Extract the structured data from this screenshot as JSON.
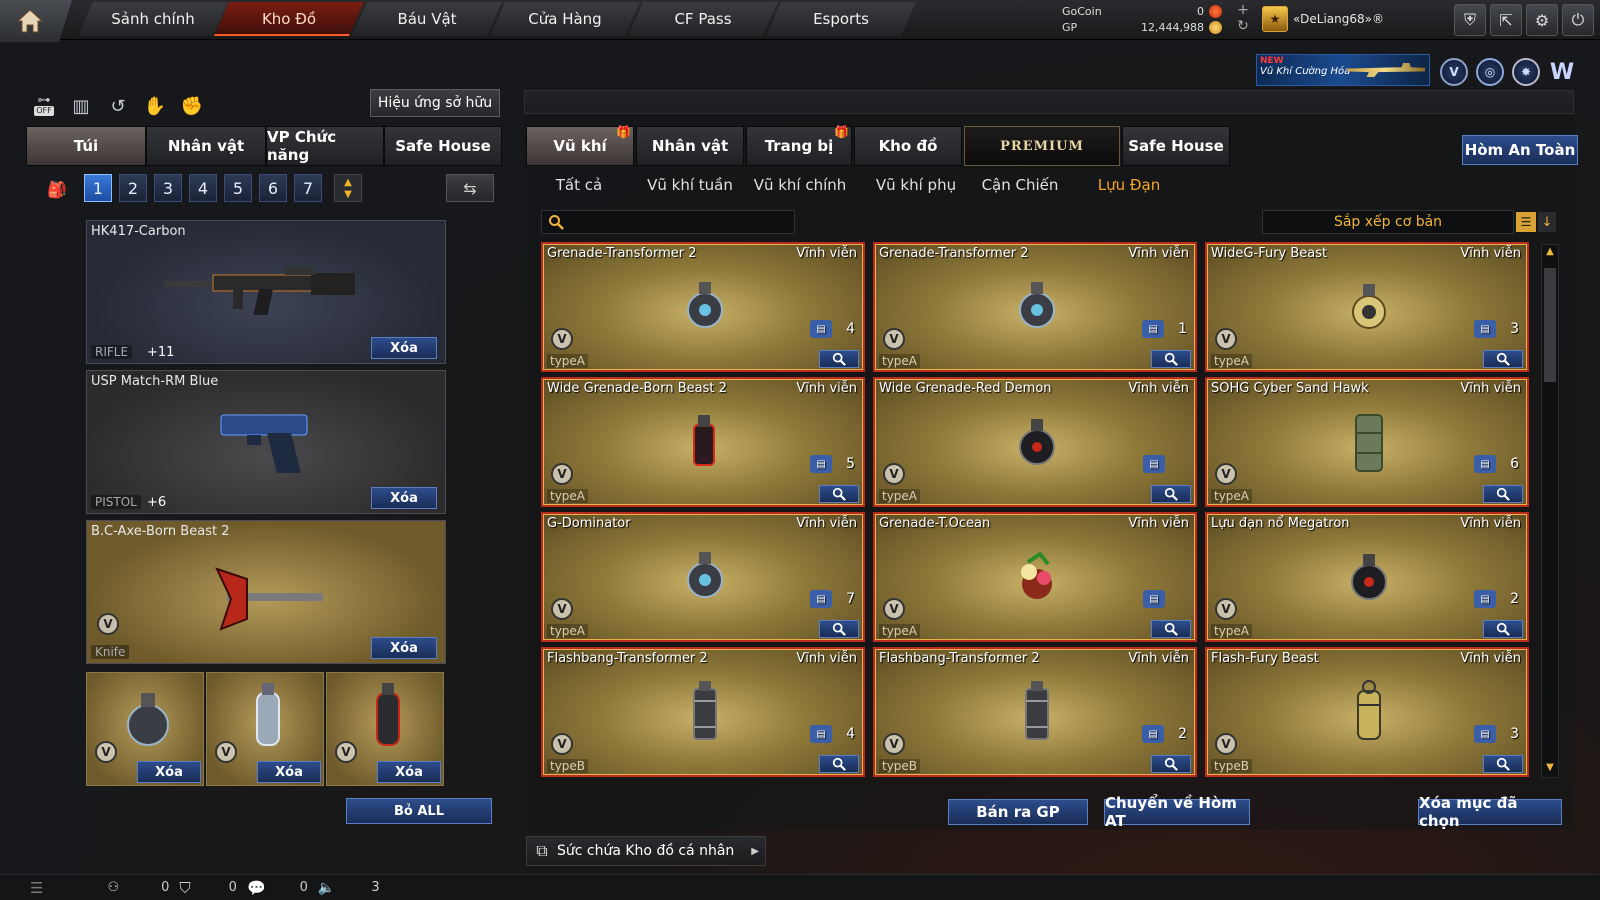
{
  "nav": {
    "tabs": [
      {
        "label": "Sảnh chính"
      },
      {
        "label": "Kho Đồ"
      },
      {
        "label": "Báu Vật"
      },
      {
        "label": "Cửa Hàng"
      },
      {
        "label": "CF Pass"
      },
      {
        "label": "Esports"
      }
    ],
    "active_index": 1
  },
  "currency": {
    "gocoin_label": "GoCoin",
    "gocoin_value": "0",
    "gp_label": "GP",
    "gp_value": "12,444,988"
  },
  "user": {
    "name": "«DeLiang68»®"
  },
  "banner": {
    "new_label": "NEW",
    "text": "Vũ Khí Cường Hóa"
  },
  "left": {
    "effects_button": "Hiệu ứng sở hữu",
    "off_label": "OFF",
    "tabs": [
      "Túi",
      "Nhân vật",
      "VP Chức năng",
      "Safe House"
    ],
    "active_tab": 0,
    "pages": [
      "1",
      "2",
      "3",
      "4",
      "5",
      "6",
      "7"
    ],
    "active_page": 0,
    "slots": [
      {
        "name": "HK417-Carbon",
        "type": "RIFLE",
        "ammo": "+11",
        "remove": "Xóa"
      },
      {
        "name": "USP Match-RM Blue",
        "type": "PISTOL",
        "ammo": "+6",
        "remove": "Xóa"
      },
      {
        "name": "B.C-Axe-Born Beast 2",
        "type": "Knife",
        "remove": "Xóa"
      }
    ],
    "grenade_slots": [
      {
        "remove": "Xóa"
      },
      {
        "remove": "Xóa"
      },
      {
        "remove": "Xóa"
      }
    ],
    "remove_all": "Bỏ ALL"
  },
  "right": {
    "tabs": [
      "Vũ khí",
      "Nhân vật",
      "Trang bị",
      "Kho đồ",
      "PREMIUM",
      "Safe House"
    ],
    "active_tab": 0,
    "safe_box_button": "Hòm An Toàn",
    "subtabs": [
      "Tất cả",
      "Vũ khí tuần",
      "Vũ khí chính",
      "Vũ khí phụ",
      "Cận Chiến",
      "Lựu Đạn"
    ],
    "active_subtab": 5,
    "search_placeholder": "",
    "sort_label": "Sắp xếp cơ bản",
    "items": [
      {
        "name": "Grenade-Transformer 2",
        "duration": "Vĩnh viễn",
        "type": "typeA",
        "qty": "4",
        "kind": "grenade-round"
      },
      {
        "name": "Grenade-Transformer 2",
        "duration": "Vĩnh viễn",
        "type": "typeA",
        "qty": "1",
        "kind": "grenade-round"
      },
      {
        "name": "WideG-Fury Beast",
        "duration": "Vĩnh viễn",
        "type": "typeA",
        "qty": "3",
        "kind": "grenade-gold"
      },
      {
        "name": "Wide Grenade-Born Beast 2",
        "duration": "Vĩnh viễn",
        "type": "typeA",
        "qty": "5",
        "kind": "grenade-red"
      },
      {
        "name": "Wide Grenade-Red Demon",
        "duration": "Vĩnh viễn",
        "type": "typeA",
        "qty": "",
        "kind": "grenade-dark"
      },
      {
        "name": "SOHG Cyber Sand Hawk",
        "duration": "Vĩnh viễn",
        "type": "typeA",
        "qty": "6",
        "kind": "grenade-cyl"
      },
      {
        "name": "G-Dominator",
        "duration": "Vĩnh viễn",
        "type": "typeA",
        "qty": "7",
        "kind": "grenade-round"
      },
      {
        "name": "Grenade-T.Ocean",
        "duration": "Vĩnh viễn",
        "type": "typeA",
        "qty": "",
        "kind": "grenade-flower"
      },
      {
        "name": "Lựu đạn nổ Megatron",
        "duration": "Vĩnh viễn",
        "type": "typeA",
        "qty": "2",
        "kind": "grenade-dark"
      },
      {
        "name": "Flashbang-Transformer 2",
        "duration": "Vĩnh viễn",
        "type": "typeB",
        "qty": "4",
        "kind": "flash"
      },
      {
        "name": "Flashbang-Transformer 2",
        "duration": "Vĩnh viễn",
        "type": "typeB",
        "qty": "2",
        "kind": "flash"
      },
      {
        "name": "Flash-Fury Beast",
        "duration": "Vĩnh viễn",
        "type": "typeB",
        "qty": "3",
        "kind": "flash-gold"
      }
    ],
    "actions": {
      "sell": "Bán ra GP",
      "move_safe": "Chuyển về Hòm AT",
      "delete_selected": "Xóa mục đã chọn"
    },
    "capacity_label": "Sức chứa Kho đồ cá nhân"
  },
  "status": {
    "friends": "0",
    "clan": "0",
    "chat": "0",
    "volume": "3"
  },
  "colors": {
    "accent_orange": "#f5a623",
    "active_nav": "#7a1d12",
    "button_blue": "#2d4d8c",
    "card_border": "#b92a1f"
  }
}
